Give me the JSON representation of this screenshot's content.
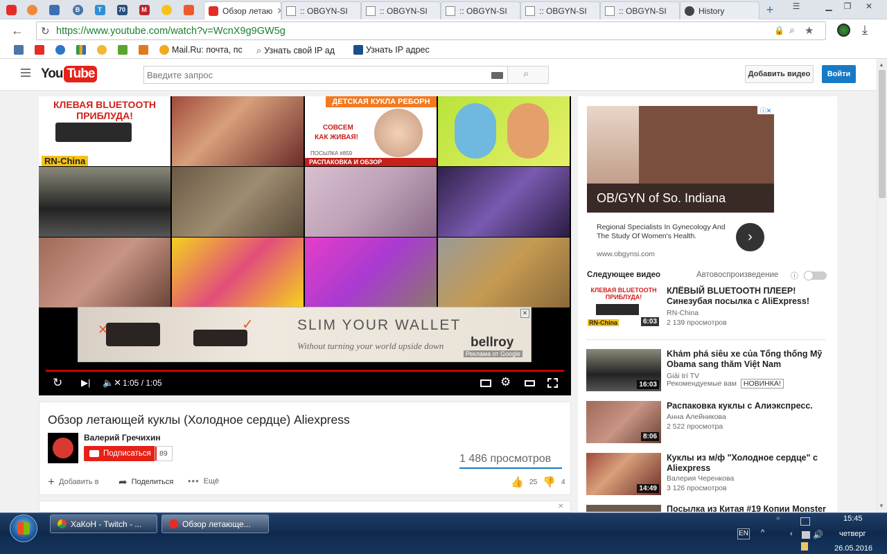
{
  "browser": {
    "tabs": [
      {
        "label": "Обзор летаю",
        "active": true
      },
      {
        "label": ":: OBGYN-SI"
      },
      {
        "label": ":: OBGYN-SI"
      },
      {
        "label": ":: OBGYN-SI"
      },
      {
        "label": ":: OBGYN-SI"
      },
      {
        "label": ":: OBGYN-SI"
      },
      {
        "label": "History"
      }
    ],
    "pinned_icons": [
      "youtube-icon",
      "feather-icon",
      "butterfly-icon",
      "vk-icon",
      "t-icon",
      "70-icon",
      "m-icon",
      "sun-icon",
      "mail-icon"
    ],
    "url": "https://www.youtube.com/watch?v=WcnX9g9GW5g",
    "bookmarks": [
      {
        "label": "",
        "icon": "vk-icon"
      },
      {
        "label": "",
        "icon": "youtube-icon"
      },
      {
        "label": "",
        "icon": "globe-icon"
      },
      {
        "label": "",
        "icon": "chart-icon"
      },
      {
        "label": "",
        "icon": "sun-icon"
      },
      {
        "label": "",
        "icon": "dollar-icon"
      },
      {
        "label": "",
        "icon": "fox-icon"
      },
      {
        "label": "Mail.Ru: почта, пс",
        "icon": "mailru-icon"
      },
      {
        "label": "Узнать свой IP ад",
        "icon": "search-icon"
      },
      {
        "label": "Узнать IP адрес",
        "icon": "ip-icon"
      }
    ]
  },
  "youtube": {
    "logo_text": "You",
    "logo_tube": "Tube",
    "search_placeholder": "Введите запрос",
    "upload_label": "Добавить видео",
    "login_label": "Войти"
  },
  "player": {
    "endscreen": {
      "first_thumb_line1": "КЛЕВАЯ BLUETOOTH",
      "first_thumb_line2": "ПРИБЛУДА!",
      "first_thumb_channel": "RN-China",
      "doll_thumb_banner": "ДЕТСКАЯ КУКЛА РЕБОРН",
      "doll_thumb_text1": "СОВСЕМ",
      "doll_thumb_text2": "КАК ЖИВАЯ!",
      "doll_thumb_parcel": "ПОСЫЛКА #859",
      "doll_thumb_bottom": "РАСПАКОВКА И ОБЗОР"
    },
    "ad": {
      "headline": "SLIM YOUR WALLET",
      "subline": "Without turning your world upside down",
      "brand": "bellroy",
      "google_label": "Реклама от Google"
    },
    "time": "1:05 / 1:05",
    "progress": 1.0
  },
  "video": {
    "title": "Обзор летающей куклы (Холодное сердце) Aliexpress",
    "channel": "Валерий Гречихин",
    "subscribe_label": "Подписаться",
    "subscriber_count": "89",
    "views": "1 486 просмотров",
    "add_to": "Добавить в",
    "share": "Поделиться",
    "more": "Ещё",
    "likes": "25",
    "dislikes": "4"
  },
  "sidebar": {
    "ad": {
      "headline": "OB/GYN of So. Indiana",
      "text": "Regional Specialists In Gynecology And The Study Of Women's Health.",
      "url": "www.obgynsi.com"
    },
    "next_label": "Следующее видео",
    "autoplay_label": "Автовоспроизведение",
    "videos": [
      {
        "title": "КЛЁВЫЙ BLUETOOTH ПЛЕЕР! Синезубая посылка с AliExpress!",
        "channel": "RN-China",
        "views": "2 139 просмотров",
        "duration": "6:03"
      },
      {
        "title": "Khám phá siêu xe của Tổng thống Mỹ Obama sang thăm Việt Nam",
        "channel": "Giải trí TV",
        "views": "Рекомендуемые вам",
        "badge": "НОВИНКА!",
        "duration": "16:03"
      },
      {
        "title": "Распаковка куклы с Алиэкспресс.",
        "channel": "Анна Алейникова",
        "views": "2 522 просмотра",
        "duration": "8:06"
      },
      {
        "title": "Куклы из м/ф \"Холодное сердце\" с Aliexpress",
        "channel": "Валерия Черенкова",
        "views": "3 126 просмотров",
        "duration": "14:49"
      },
      {
        "title": "Посылка из Китая #19 Копии Monster",
        "channel": "",
        "views": "",
        "duration": ""
      }
    ]
  },
  "taskbar": {
    "buttons": [
      {
        "label": "ХаКоН - Twitch - ...",
        "icon": "chrome-icon"
      },
      {
        "label": "Обзор летающе...",
        "icon": "yandex-icon"
      }
    ],
    "lang": "EN",
    "time": "15:45",
    "day": "четверг",
    "date": "26.05.2016"
  }
}
